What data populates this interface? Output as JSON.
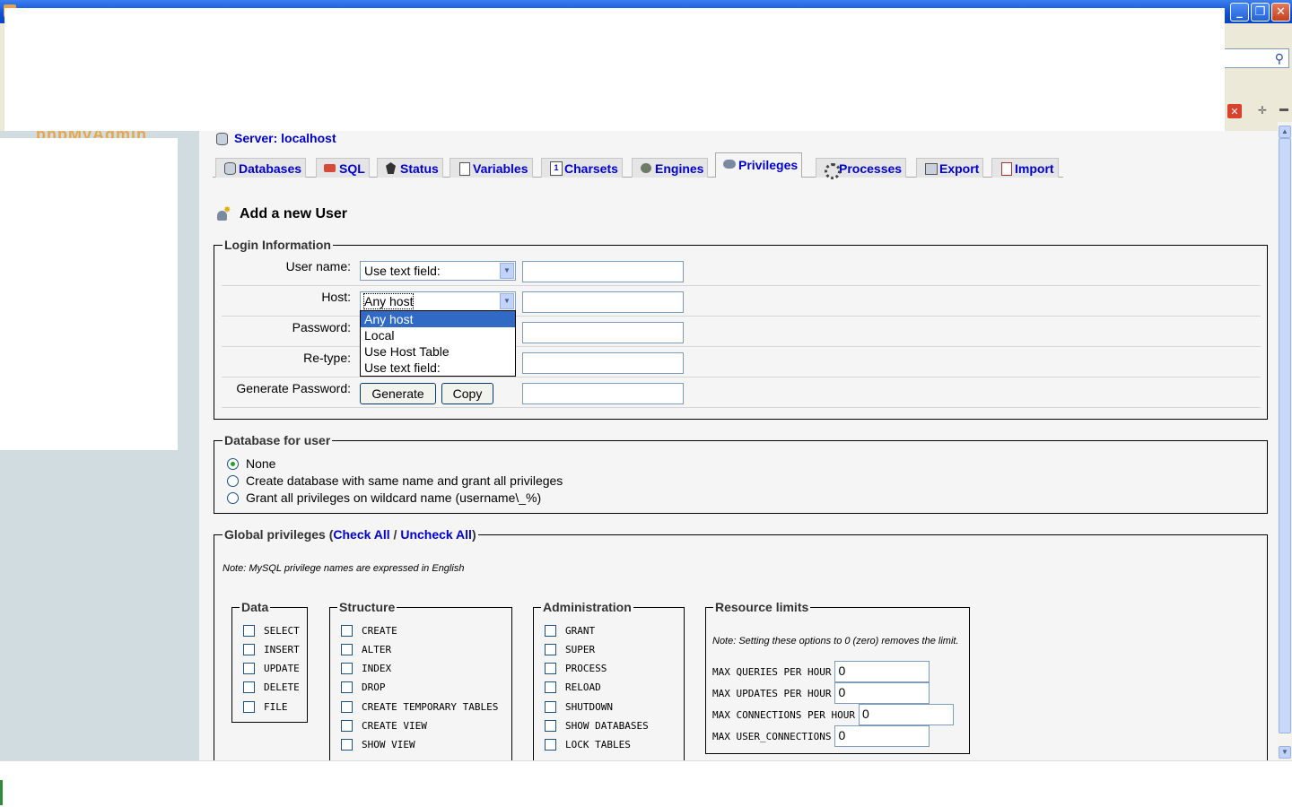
{
  "server": {
    "label": "Server: localhost"
  },
  "tabs": [
    {
      "label": "Databases",
      "icon": "database-icon"
    },
    {
      "label": "SQL",
      "icon": "sql-icon"
    },
    {
      "label": "Status",
      "icon": "status-icon"
    },
    {
      "label": "Variables",
      "icon": "variables-icon"
    },
    {
      "label": "Charsets",
      "icon": "charsets-icon"
    },
    {
      "label": "Engines",
      "icon": "engines-icon"
    },
    {
      "label": "Privileges",
      "icon": "privileges-icon",
      "active": true
    },
    {
      "label": "Processes",
      "icon": "processes-icon"
    },
    {
      "label": "Export",
      "icon": "export-icon"
    },
    {
      "label": "Import",
      "icon": "import-icon"
    }
  ],
  "page": {
    "title": "Add a new User"
  },
  "login": {
    "legend": "Login Information",
    "username_label": "User name:",
    "username_mode": "Use text field:",
    "host_label": "Host:",
    "host_mode": "Any host",
    "password_label": "Password:",
    "retype_label": "Re-type:",
    "generate_label": "Generate Password:",
    "generate_button": "Generate",
    "copy_button": "Copy",
    "host_options": [
      "Any host",
      "Local",
      "Use Host Table",
      "Use text field:"
    ]
  },
  "dbuser": {
    "legend": "Database for user",
    "options": [
      {
        "label": "None",
        "checked": true
      },
      {
        "label": "Create database with same name and grant all privileges",
        "checked": false
      },
      {
        "label": "Grant all privileges on wildcard name (username\\_%)",
        "checked": false
      }
    ]
  },
  "global": {
    "legend_prefix": "Global privileges (",
    "check_all": "Check All",
    "sep": " / ",
    "uncheck_all": "Uncheck All",
    "legend_suffix": ")",
    "note": "Note: MySQL privilege names are expressed in English",
    "data": {
      "legend": "Data",
      "items": [
        "SELECT",
        "INSERT",
        "UPDATE",
        "DELETE",
        "FILE"
      ]
    },
    "structure": {
      "legend": "Structure",
      "items": [
        "CREATE",
        "ALTER",
        "INDEX",
        "DROP",
        "CREATE TEMPORARY TABLES",
        "CREATE VIEW",
        "SHOW VIEW"
      ]
    },
    "administration": {
      "legend": "Administration",
      "items": [
        "GRANT",
        "SUPER",
        "PROCESS",
        "RELOAD",
        "SHUTDOWN",
        "SHOW DATABASES",
        "LOCK TABLES"
      ]
    },
    "resources": {
      "legend": "Resource limits",
      "note": "Note: Setting these options to 0 (zero) removes the limit.",
      "items": [
        {
          "label": "MAX QUERIES PER HOUR",
          "value": "0"
        },
        {
          "label": "MAX UPDATES PER HOUR",
          "value": "0"
        },
        {
          "label": "MAX CONNECTIONS PER HOUR",
          "value": "0"
        },
        {
          "label": "MAX USER_CONNECTIONS",
          "value": "0"
        }
      ]
    }
  },
  "colors": {
    "link": "#0000cc",
    "frame_bg": "#f5f5f5",
    "left_frame": "#d0dce0",
    "titlebar": "#0a4fd6"
  }
}
